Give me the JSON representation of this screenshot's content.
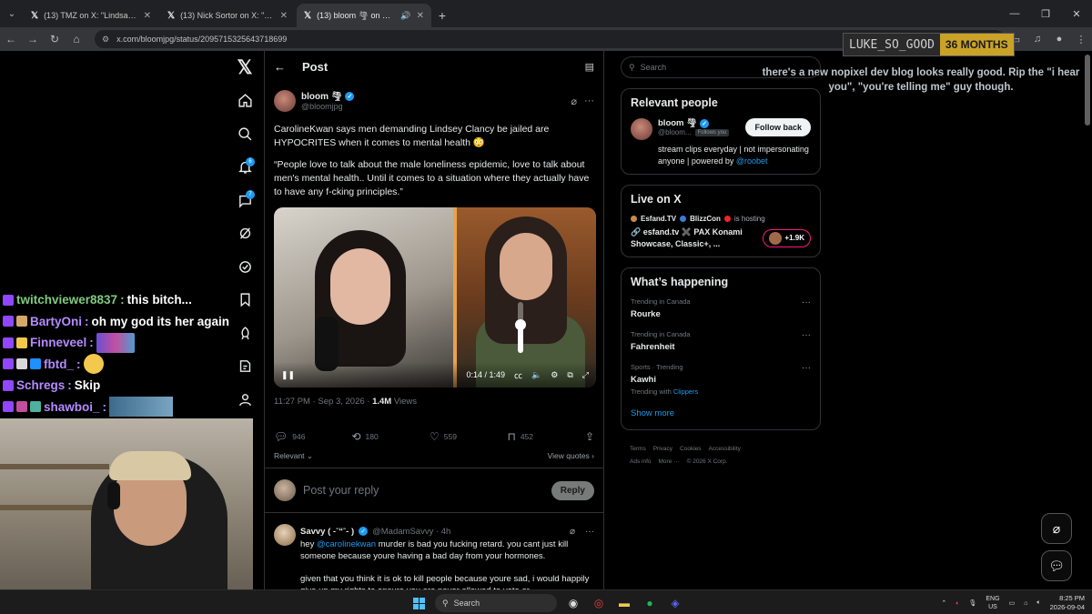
{
  "browser": {
    "tabs": [
      {
        "label": "(13) TMZ on X: \"Lindsay Clancy",
        "active": false
      },
      {
        "label": "(13) Nick Sortor on X: \"🚨 Lind",
        "active": false
      },
      {
        "label": "(13) bloom 🌪 on X: \"Carolin",
        "active": true
      }
    ],
    "url": "x.com/bloomjpg/status/2095715325643718699"
  },
  "sub_badge": {
    "username": "LUKE_SO_GOOD",
    "months": "36 MONTHS"
  },
  "overlay_text": "there's a new nopixel dev blog looks really good. Rip the \"i hear you\", \"you're telling me\" guy though.",
  "chat": [
    {
      "user": "twitchviewer8837",
      "message": "this bitch..."
    },
    {
      "user": "BartyOni",
      "message": "oh my god its her again"
    },
    {
      "user": "Finneveel",
      "message": ""
    },
    {
      "user": "fbtd_",
      "message": ""
    },
    {
      "user": "Schregs",
      "message": "Skip"
    },
    {
      "user": "shawboi_",
      "message": ""
    }
  ],
  "nav": {
    "notification_count": "6",
    "messages_count": "7"
  },
  "post": {
    "header_title": "Post",
    "author_name": "bloom 🌪",
    "author_handle": "@bloomjpg",
    "text_1": "CarolineKwan says men demanding Lindsey Clancy be jailed are HYPOCRITES when it comes to mental health 😳",
    "text_2": "“People love to talk about the male loneliness epidemic, love to talk about men's mental health.. Until it comes to a situation where they actually have to have any f-cking principles.”",
    "video_time": "0:14 / 1:49",
    "volume_level": 0.55,
    "timestamp": "11:27 PM · Sep 3, 2026 · ",
    "views": "1.4M",
    "views_label": " Views",
    "replies": "946",
    "reposts": "180",
    "likes": "559",
    "bookmarks": "452",
    "relevant_label": "Relevant",
    "view_quotes": "View quotes"
  },
  "reply_box": {
    "placeholder": "Post your reply",
    "button": "Reply"
  },
  "reply": {
    "name": "Savvy ( -ˉ“ˉ- )",
    "handle": "@MadamSavvy · 4h",
    "text_pre": "hey ",
    "mention": "@carolinekwan",
    "text_post": " murder is bad you fucking retard. you cant just kill someone because youre having a bad day from your hormones.",
    "text_2": "given that you think it is ok to kill people because youre sad, i would happily give up my rights to ensure you are never allowed to vote or"
  },
  "sidebar": {
    "search_placeholder": "Search",
    "relevant": {
      "title": "Relevant people",
      "name": "bloom 🌪",
      "handle": "@bloom...",
      "follows_you": "Follows you",
      "follow_button": "Follow back",
      "bio": "stream clips everyday | not impersonating anyone | powered by ",
      "bio_link": "@roobet"
    },
    "live": {
      "title": "Live on X",
      "host_1": "Esfand.TV",
      "host_2": "BlizzCon",
      "hosting_label": "is hosting",
      "stream_title": "🔗 esfand.tv ✖️ PAX Konami Showcase, Classic+, ...",
      "listeners": "+1.9K"
    },
    "happening": {
      "title": "What’s happening",
      "trends": [
        {
          "context": "Trending in Canada",
          "topic": "Rourke",
          "with": "",
          "with_link": ""
        },
        {
          "context": "Trending in Canada",
          "topic": "Fahrenheit",
          "with": "",
          "with_link": ""
        },
        {
          "context": "Sports · Trending",
          "topic": "Kawhi",
          "with": "Trending with ",
          "with_link": "Clippers"
        }
      ],
      "show_more": "Show more"
    },
    "footer": [
      "Terms",
      "Privacy",
      "Cookies",
      "Accessibility",
      "Ads info",
      "More ···",
      "© 2026 X Corp."
    ]
  },
  "taskbar": {
    "search": "Search",
    "lang_1": "ENG",
    "lang_2": "US",
    "time": "8:25 PM",
    "date": "2026-09-04"
  }
}
